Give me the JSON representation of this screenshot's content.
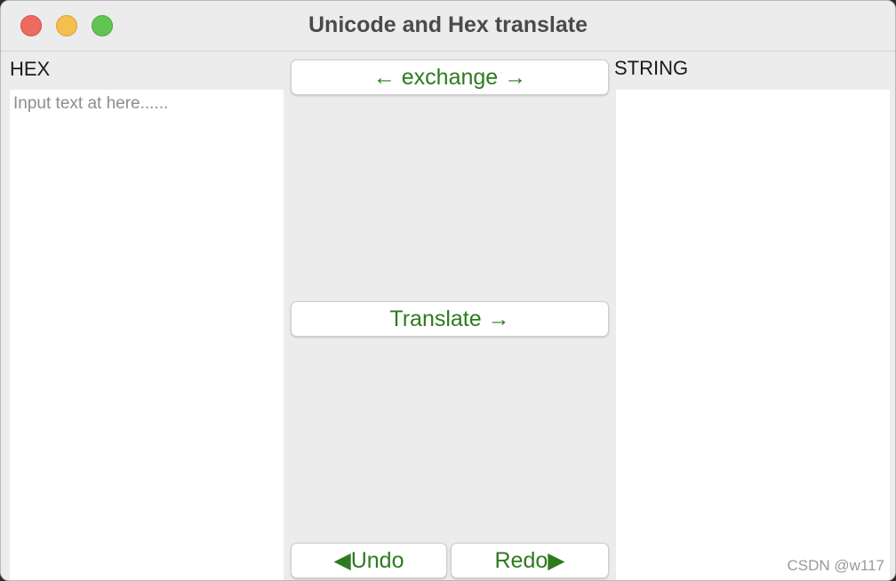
{
  "window": {
    "title": "Unicode and Hex translate"
  },
  "hex_panel": {
    "label": "HEX",
    "placeholder": "Input text at here......"
  },
  "string_panel": {
    "label": "STRING",
    "value": ""
  },
  "buttons": {
    "exchange": "← exchange →",
    "translate": "Translate →",
    "undo": "◀Undo",
    "redo": "Redo▶"
  },
  "watermark": "CSDN @w117",
  "colors": {
    "button_text": "#2d7a1f",
    "close": "#ed6a5e",
    "minimize": "#f5bf4f",
    "maximize": "#61c554"
  }
}
